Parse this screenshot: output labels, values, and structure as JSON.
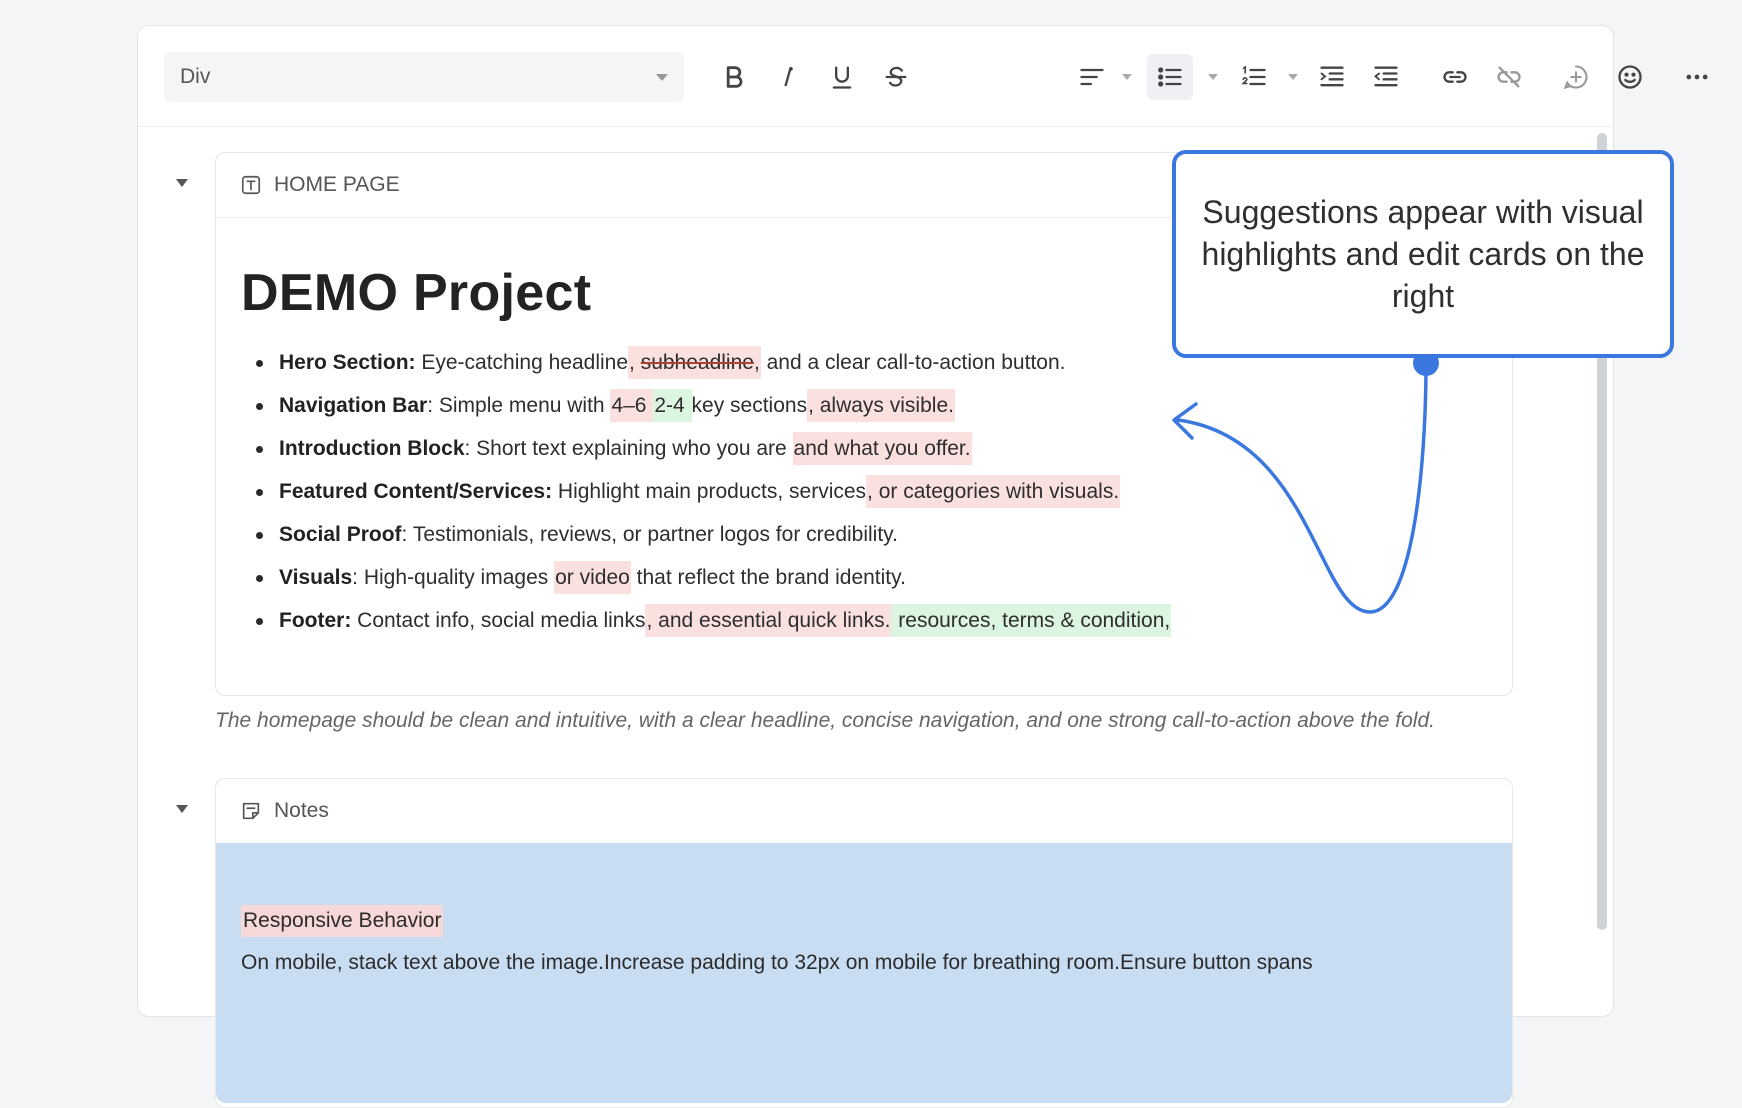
{
  "toolbar": {
    "block_type": "Div",
    "icons": [
      "bold-icon",
      "italic-icon",
      "underline-icon",
      "strikethrough-icon",
      "align-icon",
      "bullet-list-icon",
      "numbered-list-icon",
      "indent-icon",
      "outdent-icon",
      "link-icon",
      "unlink-icon",
      "add-comment-icon",
      "emoji-icon",
      "more-icon"
    ]
  },
  "home_section": {
    "label": "HOME PAGE",
    "title": "DEMO Project",
    "items": [
      {
        "label": "Hero Section:",
        "t1": " Eye-catching headline",
        "del1": ", subheadline,",
        "t2": " and a clear call-to-action button."
      },
      {
        "label": "Navigation Bar",
        "t1": ": Simple menu with ",
        "del1": "4–6 ",
        "ins1": " 2-4 ",
        "t2": "key sections",
        "del2": ", always visible."
      },
      {
        "label": "Introduction Block",
        "t1": ": Short text explaining who you are ",
        "del1": "and what you offer."
      },
      {
        "label": "Featured Content/Services:",
        "t1": " Highlight main products, services",
        "del1": ", or categories with visuals."
      },
      {
        "label": "Social Proof",
        "t1": ": Testimonials, reviews, or partner logos for credibility."
      },
      {
        "label": "Visuals",
        "t1": ": High-quality images ",
        "del1": "or video",
        "t2": " that reflect the brand identity."
      },
      {
        "label": "Footer:",
        "t1": " Contact info, social media links",
        "del1": ", and essential quick links.",
        "ins1": " resources, terms & condition,"
      }
    ]
  },
  "caption": "The homepage should be clean and intuitive, with a clear headline, concise navigation, and one strong call-to-action above the fold.",
  "notes_section": {
    "label": "Notes",
    "highlight": "Responsive Behavior",
    "body": "On mobile, stack text above the image.Increase padding to 32px on mobile for breathing room.Ensure button spans"
  },
  "callout": "Suggestions appear with visual highlights and edit cards on the right",
  "colors": {
    "accent": "#3a78e0",
    "deletion": "#fbe0e0",
    "insertion": "#dcf5e0",
    "notes_bg": "#c8ddf2"
  }
}
